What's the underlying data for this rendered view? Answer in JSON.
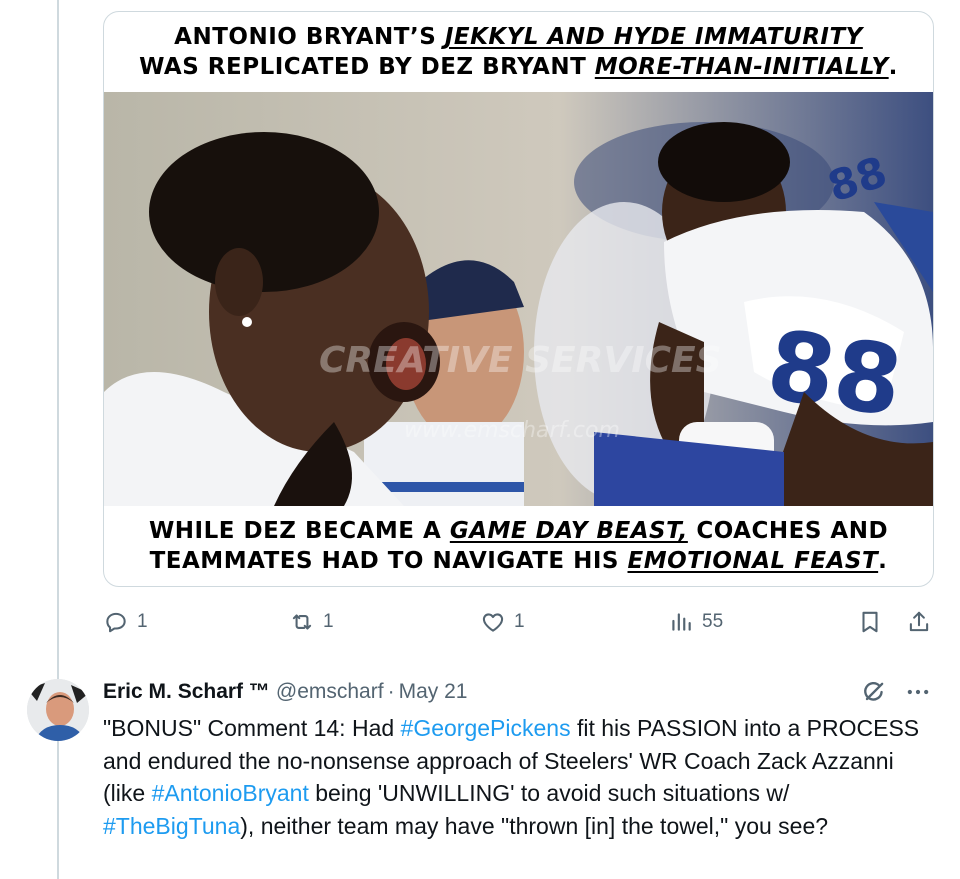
{
  "media_card": {
    "top_caption": {
      "line1_plain": "ANTONIO BRYANT’S ",
      "line1_em": "JEKKYL AND HYDE IMMATURITY",
      "line2_plain": "WAS REPLICATED BY DEZ BRYANT ",
      "line2_em": "MORE-THAN-INITIALLY",
      "line2_end": "."
    },
    "bottom_caption": {
      "line1_plain_a": "WHILE DEZ BECAME A ",
      "line1_em": "GAME DAY BEAST,",
      "line1_plain_b": " COACHES AND",
      "line2_plain": "TEAMMATES HAD TO NAVIGATE HIS ",
      "line2_em": "EMOTIONAL FEAST",
      "line2_end": "."
    },
    "jersey_number": "88",
    "watermark_1": "CREATIVE SERVICES",
    "watermark_2": "www.emscharf.com"
  },
  "actions": {
    "reply_count": "1",
    "repost_count": "1",
    "like_count": "1",
    "views_count": "55",
    "icons": [
      "reply-icon",
      "repost-icon",
      "like-icon",
      "views-icon",
      "bookmark-icon",
      "share-icon"
    ]
  },
  "tweet": {
    "name": "Eric M. Scharf ™",
    "handle": "@emscharf",
    "separator": "·",
    "date": "May 21",
    "body": {
      "t1": "\"BONUS\" Comment 14: Had ",
      "h1": "#GeorgePickens",
      "t2": " fit his PASSION into a PROCESS and endured the no-nonsense approach of Steelers' WR Coach Zack Azzanni (like ",
      "h2": "#AntonioBryant",
      "t3": " being 'UNWILLING' to avoid such situations w/ ",
      "h3": "#TheBigTuna",
      "t4": "), neither team may have \"thrown [in] the towel,\" you see?"
    },
    "icons": [
      "grok-icon",
      "more-icon"
    ]
  },
  "colors": {
    "link": "#1d9bf0",
    "muted": "#536471",
    "border": "#cfd9de"
  }
}
